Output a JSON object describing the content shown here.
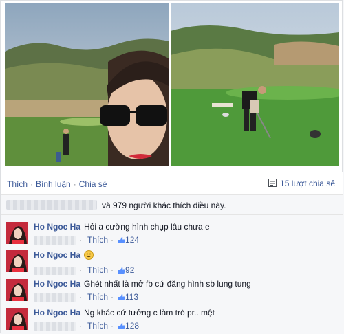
{
  "actions": {
    "like": "Thích",
    "comment": "Bình luận",
    "share": "Chia sẻ",
    "share_count": "15 lượt chia sẻ"
  },
  "likes": {
    "text": "và 979 người khác thích điều này."
  },
  "comments": [
    {
      "author": "Ho Ngoc Ha",
      "text": "Hỏi a cường hình chụp lâu chưa e",
      "like": "Thích",
      "count": "124"
    },
    {
      "author": "Ho Ngoc Ha",
      "text": "",
      "emoji": "smiley",
      "like": "Thích",
      "count": "92"
    },
    {
      "author": "Ho Ngoc Ha",
      "text": "Ghét nhất là mở fb cứ đăng hình sb lung tung",
      "like": "Thích",
      "count": "113"
    },
    {
      "author": "Ho Ngoc Ha",
      "text": "Ng khác cứ tưởng c làm trò pr.. mệt",
      "like": "Thích",
      "count": "128"
    }
  ],
  "colors": {
    "link": "#3b5998",
    "text": "#141823",
    "muted": "#90949c"
  },
  "icons": {
    "share": "share-icon",
    "thumb": "thumbs-up-icon",
    "smiley": "smiley-icon"
  }
}
